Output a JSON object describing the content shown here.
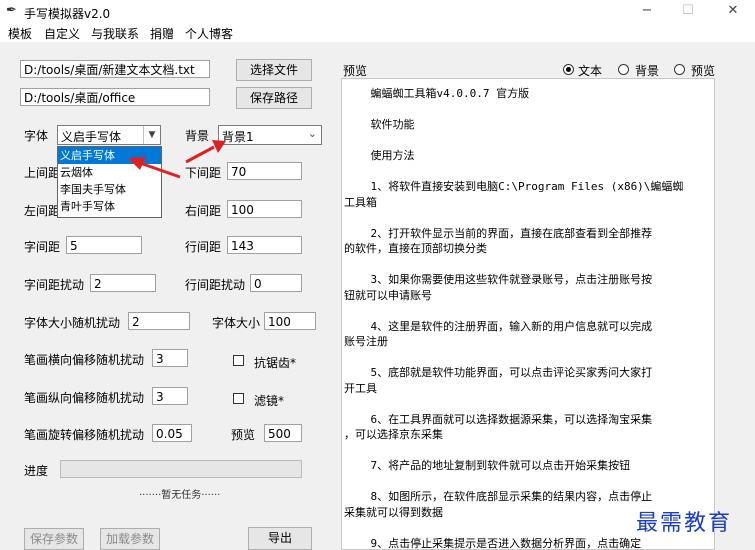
{
  "window": {
    "title": "手写模拟器v2.0",
    "minimize": "−",
    "maximize": "☐",
    "close": "✕"
  },
  "menu": [
    "模板",
    "自定义",
    "与我联系",
    "捐赠",
    "个人博客"
  ],
  "files": {
    "text_path": "D:/tools/桌面/新建文本文档.txt",
    "save_path": "D:/tools/桌面/office",
    "choose_file": "选择文件",
    "save_path_btn": "保存路径"
  },
  "font": {
    "label": "字体",
    "selected": "义启手写体",
    "options": [
      "义启手写体",
      "云烟体",
      "李国夫手写体",
      "青叶手写体"
    ]
  },
  "background": {
    "label": "背景",
    "selected": "背景1"
  },
  "params": {
    "top_margin_label": "上间距",
    "bottom_margin_label": "下间距",
    "bottom_margin": "70",
    "left_margin_label": "左间距",
    "right_margin_label": "右间距",
    "right_margin": "100",
    "char_spacing_label": "字间距",
    "char_spacing": "5",
    "line_spacing_label": "行间距",
    "line_spacing": "143",
    "char_jitter_label": "字间距扰动",
    "char_jitter": "2",
    "line_jitter_label": "行间距扰动",
    "line_jitter": "0",
    "size_jitter_label": "字体大小随机扰动",
    "size_jitter": "2",
    "font_size_label": "字体大小",
    "font_size": "100",
    "h_offset_label": "笔画横向偏移随机扰动",
    "h_offset": "3",
    "antialias_label": "抗锯齿*",
    "v_offset_label": "笔画纵向偏移随机扰动",
    "v_offset": "3",
    "filter_label": "滤镜*",
    "rot_offset_label": "笔画旋转偏移随机扰动",
    "rot_offset": "0.05",
    "preview_label": "预览",
    "preview_value": "500"
  },
  "progress": {
    "label": "进度",
    "status": "·······暂无任务······",
    "value": 0
  },
  "buttons": {
    "save_params": "保存参数",
    "load_params": "加载参数",
    "export": "导出"
  },
  "preview_panel": {
    "label": "预览",
    "radios": [
      "文本",
      "背景",
      "预览"
    ],
    "selected_radio": "文本",
    "lines": [
      "    蝙蝠蜘工具箱v4.0.0.7 官方版",
      "",
      "    软件功能",
      "",
      "    使用方法",
      "",
      "    1、将软件直接安装到电脑C:\\Program Files (x86)\\蝙蝠蜘",
      "工具箱",
      "",
      "    2、打开软件显示当前的界面，直接在底部查看到全部推荐",
      "的软件，直接在顶部切换分类",
      "",
      "    3、如果你需要使用这些软件就登录账号，点击注册账号按",
      "钮就可以申请账号",
      "",
      "    4、这里是软件的注册界面，输入新的用户信息就可以完成",
      "账号注册",
      "",
      "    5、底部就是软件功能界面，可以点击评论买家秀问大家打",
      "开工具",
      "",
      "    6、在工具界面就可以选择数据源采集，可以选择淘宝采集",
      "，可以选择京东采集",
      "",
      "    7、将产品的地址复制到软件就可以点击开始采集按钮",
      "",
      "    8、如图所示，在软件底部显示采集的结果内容，点击停止",
      "采集就可以得到数据",
      "",
      "    9、点击停止采集提示是否进入数据分析界面，点击确定"
    ]
  },
  "watermark": "最需教育",
  "colors": {
    "selection": "#0078d7",
    "annotation_arrow": "#e02020",
    "watermark": "#1a3cc8"
  }
}
